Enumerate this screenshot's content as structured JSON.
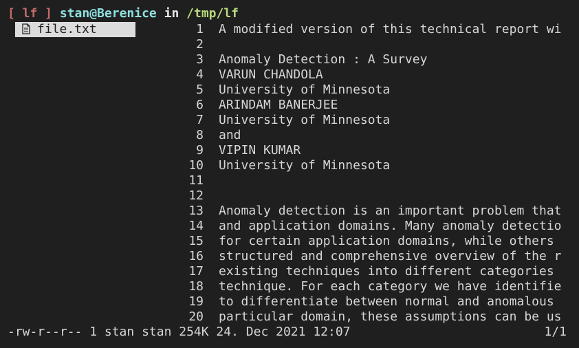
{
  "header": {
    "app_tag": "[ lf ]",
    "user_host": "stan@Berenice",
    "in_word": "in",
    "path": "/tmp/lf"
  },
  "file_list": [
    {
      "name": "file.txt",
      "icon": "document-icon",
      "selected": true
    }
  ],
  "preview": {
    "lines": [
      {
        "num": "1",
        "text": "A modified version of this technical report wi"
      },
      {
        "num": "2",
        "text": ""
      },
      {
        "num": "3",
        "text": "Anomaly Detection : A Survey"
      },
      {
        "num": "4",
        "text": "VARUN CHANDOLA"
      },
      {
        "num": "5",
        "text": "University of Minnesota"
      },
      {
        "num": "6",
        "text": "ARINDAM BANERJEE"
      },
      {
        "num": "7",
        "text": "University of Minnesota"
      },
      {
        "num": "8",
        "text": "and"
      },
      {
        "num": "9",
        "text": "VIPIN KUMAR"
      },
      {
        "num": "10",
        "text": "University of Minnesota"
      },
      {
        "num": "11",
        "text": ""
      },
      {
        "num": "12",
        "text": ""
      },
      {
        "num": "13",
        "text": "Anomaly detection is an important problem that"
      },
      {
        "num": "14",
        "text": "and application domains. Many anomaly detectio"
      },
      {
        "num": "15",
        "text": "for certain application domains, while others"
      },
      {
        "num": "16",
        "text": "structured and comprehensive overview of the r"
      },
      {
        "num": "17",
        "text": "existing techniques into different categories"
      },
      {
        "num": "18",
        "text": "technique. For each category we have identifie"
      },
      {
        "num": "19",
        "text": "to differentiate between normal and anomalous"
      },
      {
        "num": "20",
        "text": "particular domain, these assumptions can be us"
      }
    ]
  },
  "status": {
    "info": "-rw-r--r-- 1 stan stan 254K 24. Dec 2021 12:07",
    "position": "1/1"
  },
  "colors": {
    "background": "#1f1f1f",
    "app_tag": "#c26a6a",
    "user_host": "#8ee0e0",
    "path": "#b8d97a",
    "selection": "#dcdcdc"
  }
}
